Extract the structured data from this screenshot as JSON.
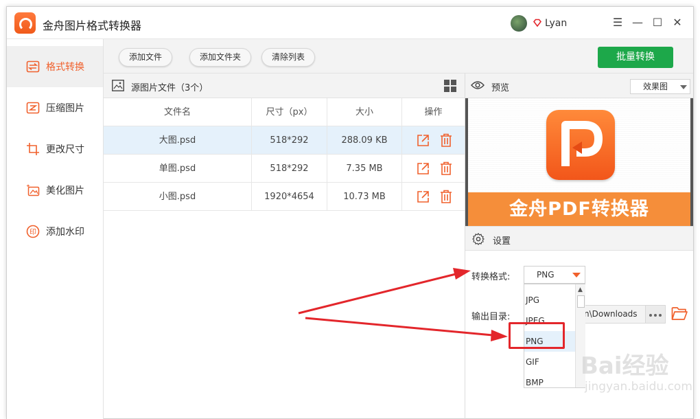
{
  "app": {
    "title": "金舟图片格式转换器",
    "user_name": "Lyan"
  },
  "window_controls": {
    "menu": "☰",
    "minimize": "—",
    "maximize": "☐",
    "close": "✕"
  },
  "sidebar": {
    "items": [
      {
        "label": "格式转换",
        "icon": "swap-icon",
        "active": true
      },
      {
        "label": "压缩图片",
        "icon": "compress-icon",
        "active": false
      },
      {
        "label": "更改尺寸",
        "icon": "crop-icon",
        "active": false
      },
      {
        "label": "美化图片",
        "icon": "beautify-icon",
        "active": false
      },
      {
        "label": "添加水印",
        "icon": "watermark-icon",
        "active": false
      }
    ]
  },
  "toolbar": {
    "add_file": "添加文件",
    "add_folder": "添加文件夹",
    "clear_list": "清除列表",
    "batch_convert": "批量转换"
  },
  "files": {
    "header": "源图片文件（3个）",
    "columns": [
      "文件名",
      "尺寸（px）",
      "大小",
      "操作"
    ],
    "rows": [
      {
        "name": "大图.psd",
        "size_px": "518*292",
        "size": "288.09 KB",
        "selected": true
      },
      {
        "name": "单图.psd",
        "size_px": "518*292",
        "size": "7.35 MB",
        "selected": false
      },
      {
        "name": "小图.psd",
        "size_px": "1920*4654",
        "size": "10.73 MB",
        "selected": false
      }
    ]
  },
  "preview": {
    "title": "预览",
    "mode": "效果图",
    "banner_text": "金舟PDF转换器"
  },
  "settings": {
    "title": "设置",
    "format_label": "转换格式:",
    "format_value": "PNG",
    "output_label": "输出目录:",
    "output_path": "n\\Downloads",
    "format_options": [
      "JPG",
      "JPEG",
      "PNG",
      "GIF",
      "BMP"
    ],
    "highlighted_option": "PNG"
  },
  "watermark": {
    "main": "Bai经验",
    "sub": "jingyan.baidu.com"
  },
  "colors": {
    "accent": "#f0602c",
    "primary_green": "#1da84a",
    "selection": "#e5f1fb",
    "annotation_red": "#e3262b"
  }
}
